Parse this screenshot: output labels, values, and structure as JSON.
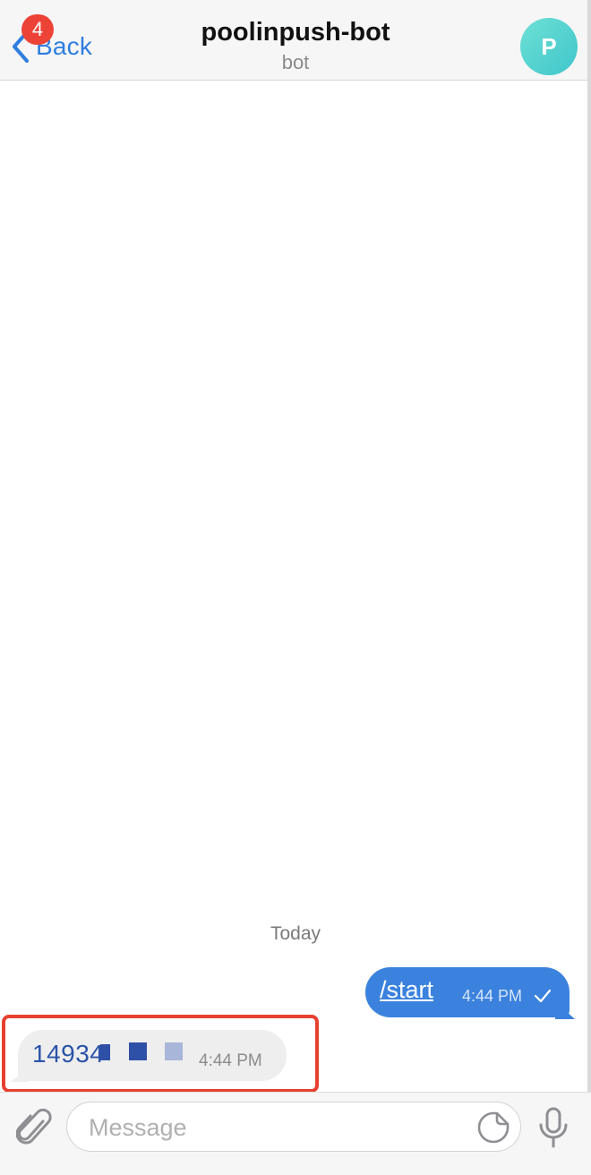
{
  "header": {
    "back_label": "Back",
    "unread_count": "4",
    "title": "poolinpush-bot",
    "subtitle": "bot",
    "avatar_letter": "P"
  },
  "chat": {
    "date_separator": "Today",
    "messages": [
      {
        "direction": "outgoing",
        "text": "/start",
        "time": "4:44 PM",
        "status": "sent-check"
      },
      {
        "direction": "incoming",
        "text": "14934",
        "time": "4:44 PM"
      }
    ]
  },
  "input": {
    "placeholder": "Message",
    "value": ""
  },
  "colors": {
    "accent": "#2f7ee0",
    "badge": "#ec4336",
    "outgoing_bubble": "#3a82dd",
    "incoming_bubble": "#eeeeee",
    "highlight": "#e8402f"
  },
  "icons": [
    "back-chevron-icon",
    "check-icon",
    "attachment-icon",
    "sticker-icon",
    "microphone-icon"
  ]
}
